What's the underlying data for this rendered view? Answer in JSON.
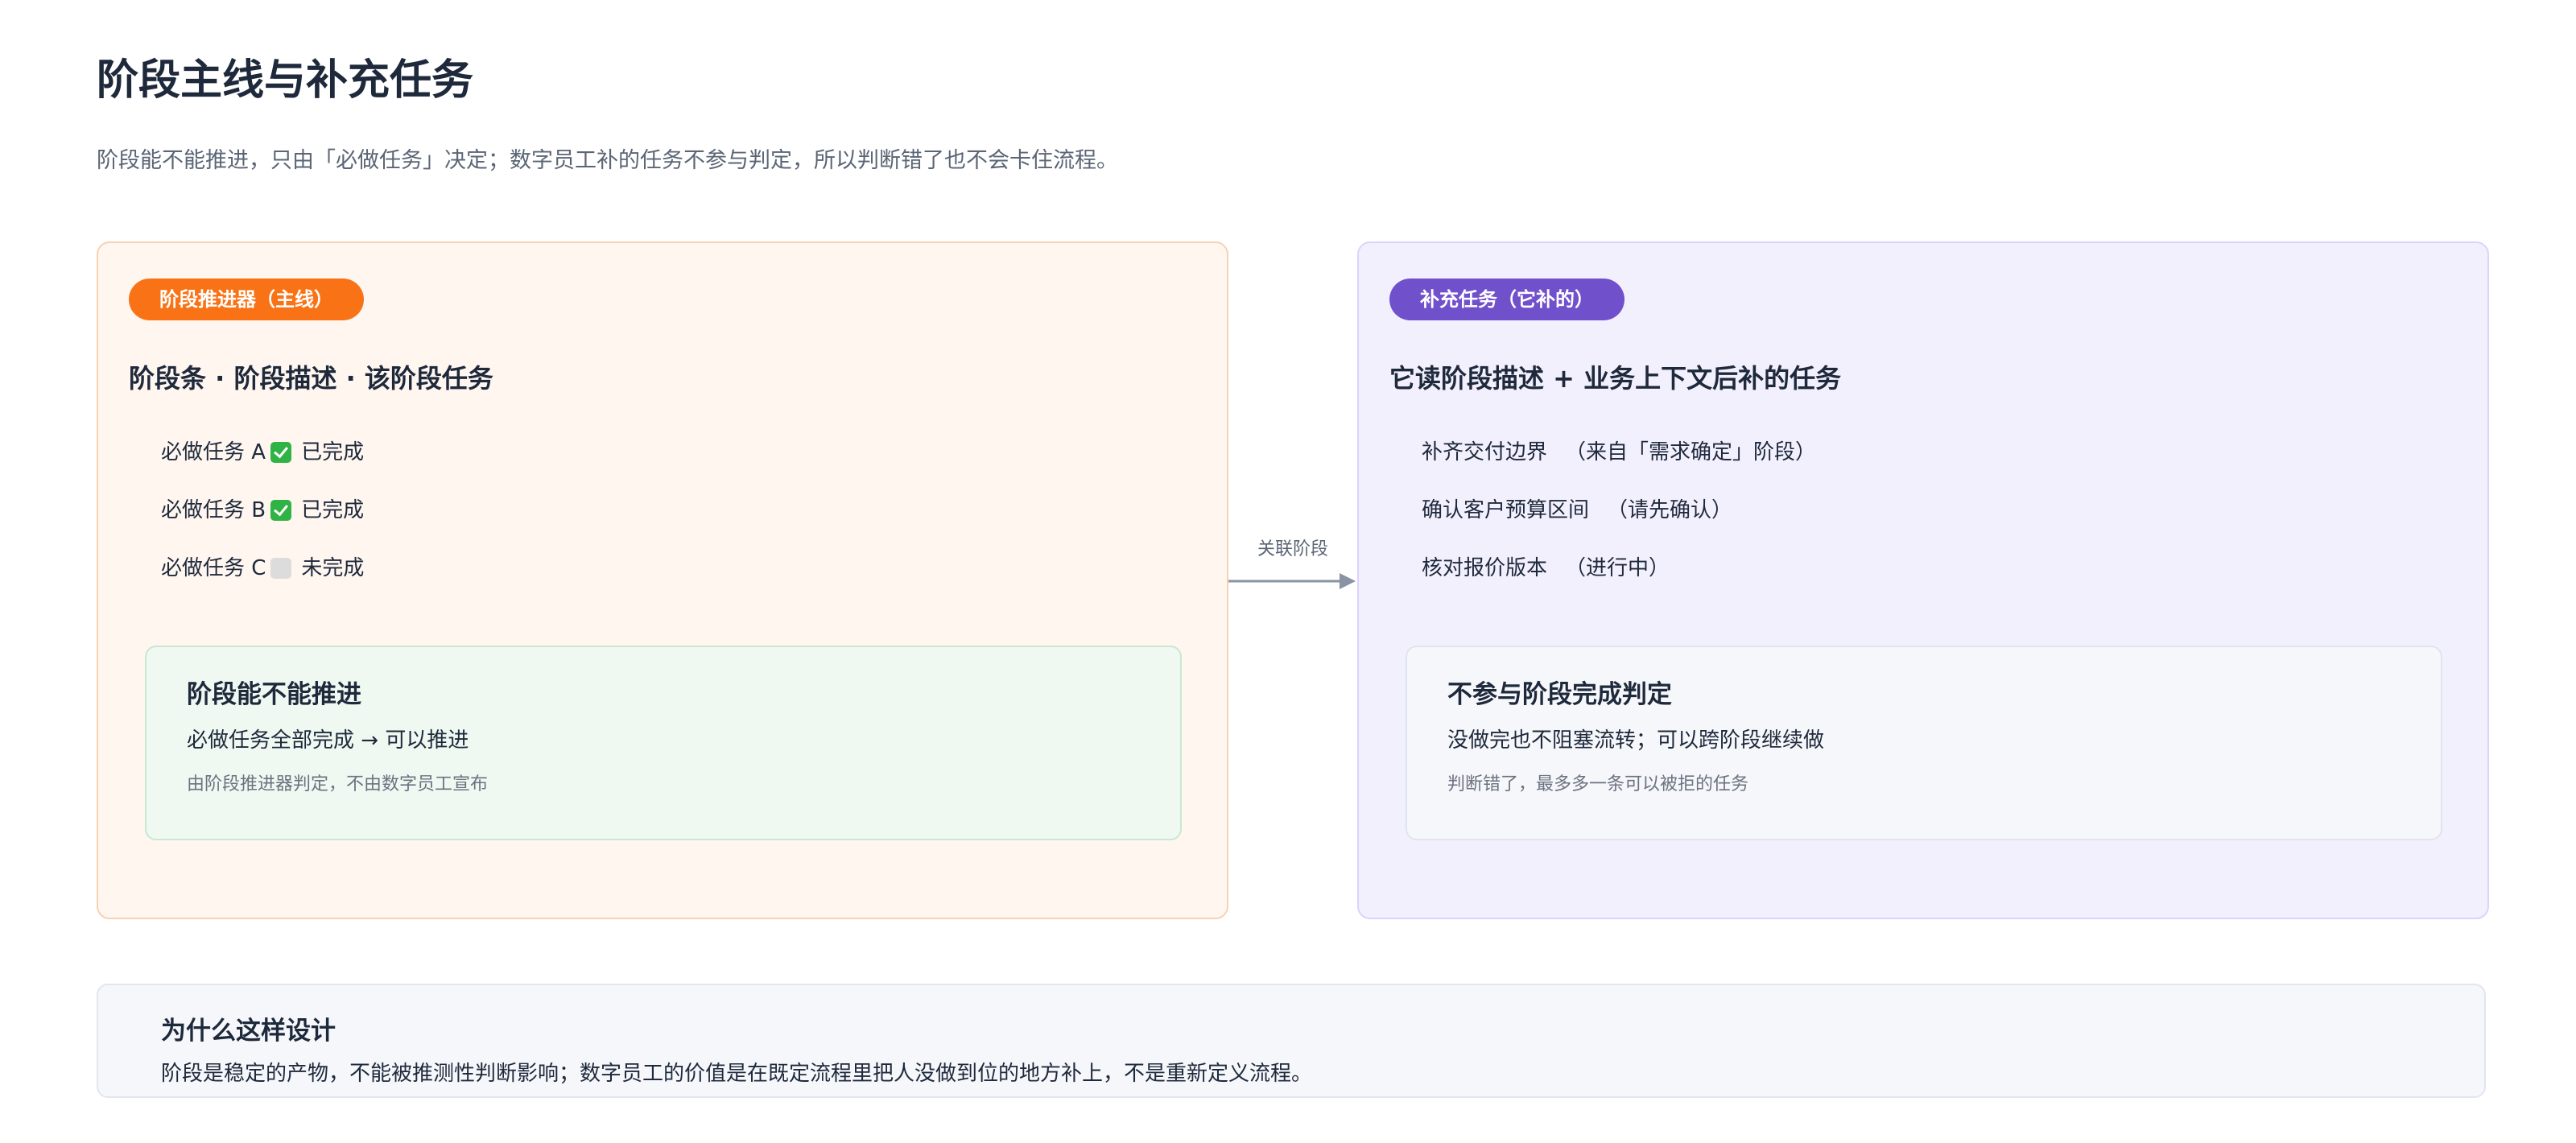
{
  "header": {
    "title": "阶段主线与补充任务",
    "subtitle": "阶段能不能推进，只由「必做任务」决定；数字员工补的任务不参与判定，所以判断错了也不会卡住流程。"
  },
  "left_panel": {
    "pill_label": "阶段推进器（主线）",
    "heading": "阶段条 · 阶段描述 · 该阶段任务",
    "tasks": [
      {
        "name": "必做任务 A",
        "icon": "check-done-icon",
        "status": "已完成"
      },
      {
        "name": "必做任务 B",
        "icon": "check-done-icon",
        "status": "已完成"
      },
      {
        "name": "必做任务 C",
        "icon": "check-empty-icon",
        "status": "未完成"
      }
    ],
    "box": {
      "title": "阶段能不能推进",
      "line": "必做任务全部完成 → 可以推进",
      "note": "由阶段推进器判定，不由数字员工宣布"
    }
  },
  "connector": {
    "label": "关联阶段"
  },
  "right_panel": {
    "pill_label": "补充任务（它补的）",
    "heading": "它读阶段描述 + 业务上下文后补的任务",
    "tasks": [
      {
        "name": "补齐交付边界",
        "note": "（来自「需求确定」阶段）"
      },
      {
        "name": "确认客户预算区间",
        "note": "（请先确认）"
      },
      {
        "name": "核对报价版本",
        "note": "（进行中）"
      }
    ],
    "box": {
      "title": "不参与阶段完成判定",
      "line": "没做完也不阻塞流转；可以跨阶段继续做",
      "note": "判断错了，最多多一条可以被拒的任务"
    }
  },
  "footer": {
    "title": "为什么这样设计",
    "text": "阶段是稳定的产物，不能被推测性判断影响；数字员工的价值是在既定流程里把人没做到位的地方补上，不是重新定义流程。"
  },
  "colors": {
    "left_accent": "#f97316",
    "right_accent": "#7150cc",
    "done_check": "#2fb344",
    "empty_check": "#dcdcdc",
    "connector": "#8a93a3"
  }
}
